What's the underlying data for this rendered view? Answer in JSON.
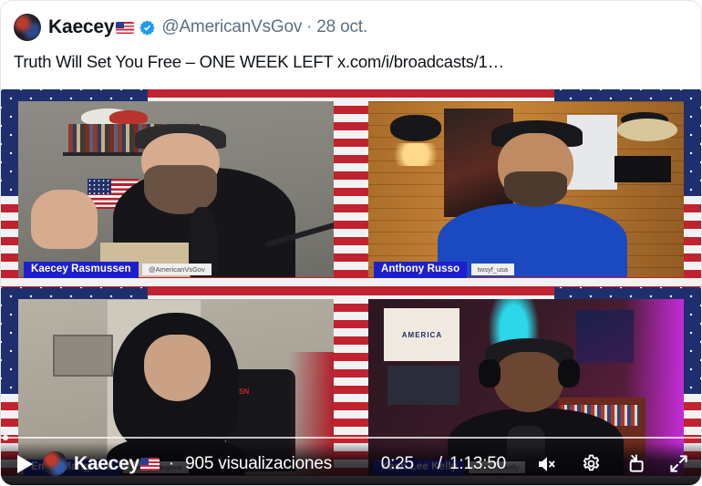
{
  "post": {
    "author_name": "Kaecey",
    "author_flag": "us-flag-icon",
    "verified": true,
    "handle": "@AmericanVsGov",
    "separator": "·",
    "date": "28 oct.",
    "text": "Truth Will Set You Free – ONE WEEK LEFT x.com/i/broadcasts/1…"
  },
  "player": {
    "participants": [
      {
        "name": "Kaecey Rasmussen",
        "handle": "@AmericanVsGov"
      },
      {
        "name": "Anthony Russo",
        "handle": "twsyf_usa"
      },
      {
        "name": "Emily Mangione",
        "handle": "@emilymangione"
      },
      {
        "name": "Kash Lee Kelly",
        "handle": "@kashleekelly"
      }
    ],
    "controls": {
      "play_label": "play-button",
      "brand_name": "Kaecey",
      "brand_flag": "us-flag-icon",
      "separator": "·",
      "views": "905 visualizaciones",
      "current_time": "0:25",
      "time_divider": "/",
      "duration": "1:13:50",
      "mute_label": "mute-toggle",
      "settings_label": "settings",
      "pip_label": "picture-in-picture",
      "fullscreen_label": "fullscreen"
    },
    "progress": {
      "played_percent": 0.6
    }
  },
  "colors": {
    "verified_blue": "#1d9bf0",
    "nameplate_blue": "#1d1fcf",
    "text_primary": "#0f1419",
    "text_secondary": "#5b7083",
    "flag_red": "#d7263d",
    "flag_blue": "#2a3d8f"
  }
}
